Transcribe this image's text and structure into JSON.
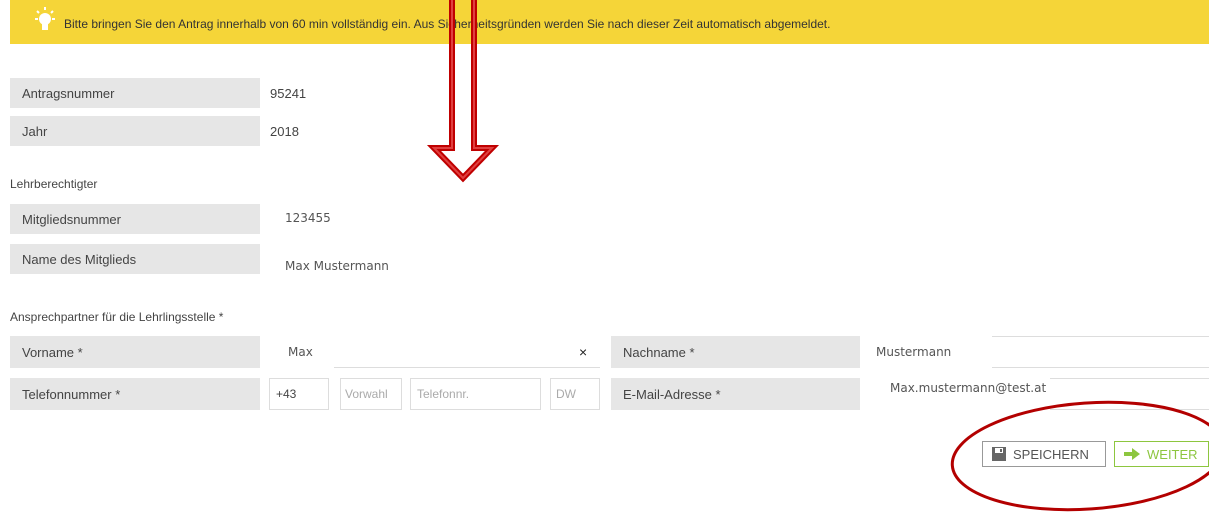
{
  "banner": {
    "icon": "lightbulb-icon",
    "message": "Bitte bringen Sie den Antrag innerhalb von 60 min vollständig ein. Aus Sicherheitsgründen werden Sie nach dieser Zeit automatisch abgemeldet."
  },
  "antrag": {
    "number_label": "Antragsnummer",
    "number_value": "95241",
    "year_label": "Jahr",
    "year_value": "2018"
  },
  "lehrberechtigter": {
    "heading": "Lehrberechtigter",
    "member_no_label": "Mitgliedsnummer",
    "member_no_value": "123455",
    "member_name_label": "Name des Mitglieds",
    "member_name_value": "Max Mustermann"
  },
  "contact": {
    "heading": "Ansprechpartner für die Lehrlingsstelle *",
    "firstname_label": "Vorname *",
    "firstname_value": "Max",
    "clear_symbol": "×",
    "lastname_label": "Nachname *",
    "lastname_value": "Mustermann",
    "phone_label": "Telefonnummer *",
    "phone_prefix": "+43",
    "area_placeholder": "Vorwahl",
    "number_placeholder": "Telefonnr.",
    "ext_placeholder": "DW",
    "email_label": "E-Mail-Adresse *",
    "email_value": "Max.mustermann@test.at"
  },
  "actions": {
    "save_label": "SPEICHERN",
    "save_icon": "floppy-disk-icon",
    "next_label": "WEITER",
    "next_icon": "arrow-right-icon",
    "next_color": "#8dc63f"
  },
  "annotations": {
    "arrow_color": "#c00000",
    "circle_color": "#b30000"
  }
}
